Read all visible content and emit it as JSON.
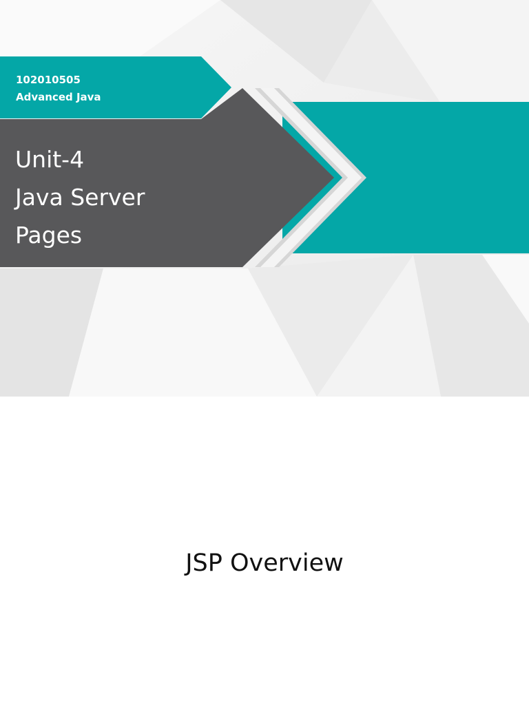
{
  "title_slide": {
    "course_code": "102010505",
    "course_name": "Advanced Java",
    "title_lines": [
      "Unit-4",
      "Java Server",
      "Pages"
    ]
  },
  "second_slide": {
    "heading": "JSP Overview"
  },
  "colors": {
    "teal": "#04a7a7",
    "dark_gray": "#58585a",
    "background_light": "#f2f2f2",
    "text_white": "#ffffff",
    "text_dark": "#111111"
  }
}
